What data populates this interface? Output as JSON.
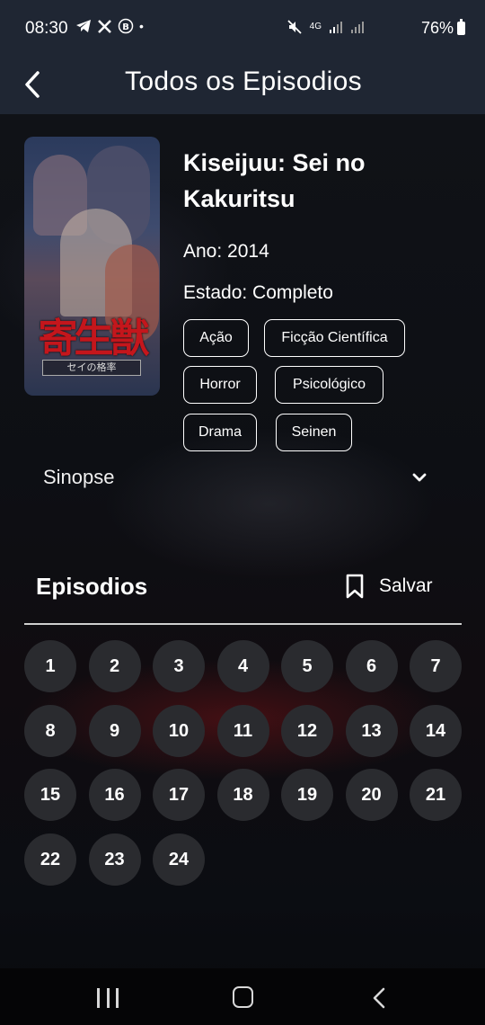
{
  "status_bar": {
    "time": "08:30",
    "left_icons": [
      "telegram-icon",
      "x-icon",
      "b-icon",
      "dot-icon"
    ],
    "network": "4G",
    "battery": "76%"
  },
  "app_bar": {
    "title": "Todos os Episodios"
  },
  "anime": {
    "title": "Kiseijuu: Sei no Kakuritsu",
    "year": "Ano: 2014",
    "status": "Estado: Completo",
    "cover_text": "寄生獣",
    "cover_subtext": "セイの格率"
  },
  "genres": [
    "Ação",
    "Ficção Científica",
    "Horror",
    "Psicológico",
    "Drama",
    "Seinen"
  ],
  "synopsis": {
    "label": "Sinopse"
  },
  "episodes_section": {
    "title": "Episodios",
    "save_label": "Salvar",
    "episodes": [
      "1",
      "2",
      "3",
      "4",
      "5",
      "6",
      "7",
      "8",
      "9",
      "10",
      "11",
      "12",
      "13",
      "14",
      "15",
      "16",
      "17",
      "18",
      "19",
      "20",
      "21",
      "22",
      "23",
      "24"
    ]
  },
  "colors": {
    "bar_background": "#1f2633",
    "episode_button": "#2a2b2f",
    "page_background": "#0c0e12"
  }
}
